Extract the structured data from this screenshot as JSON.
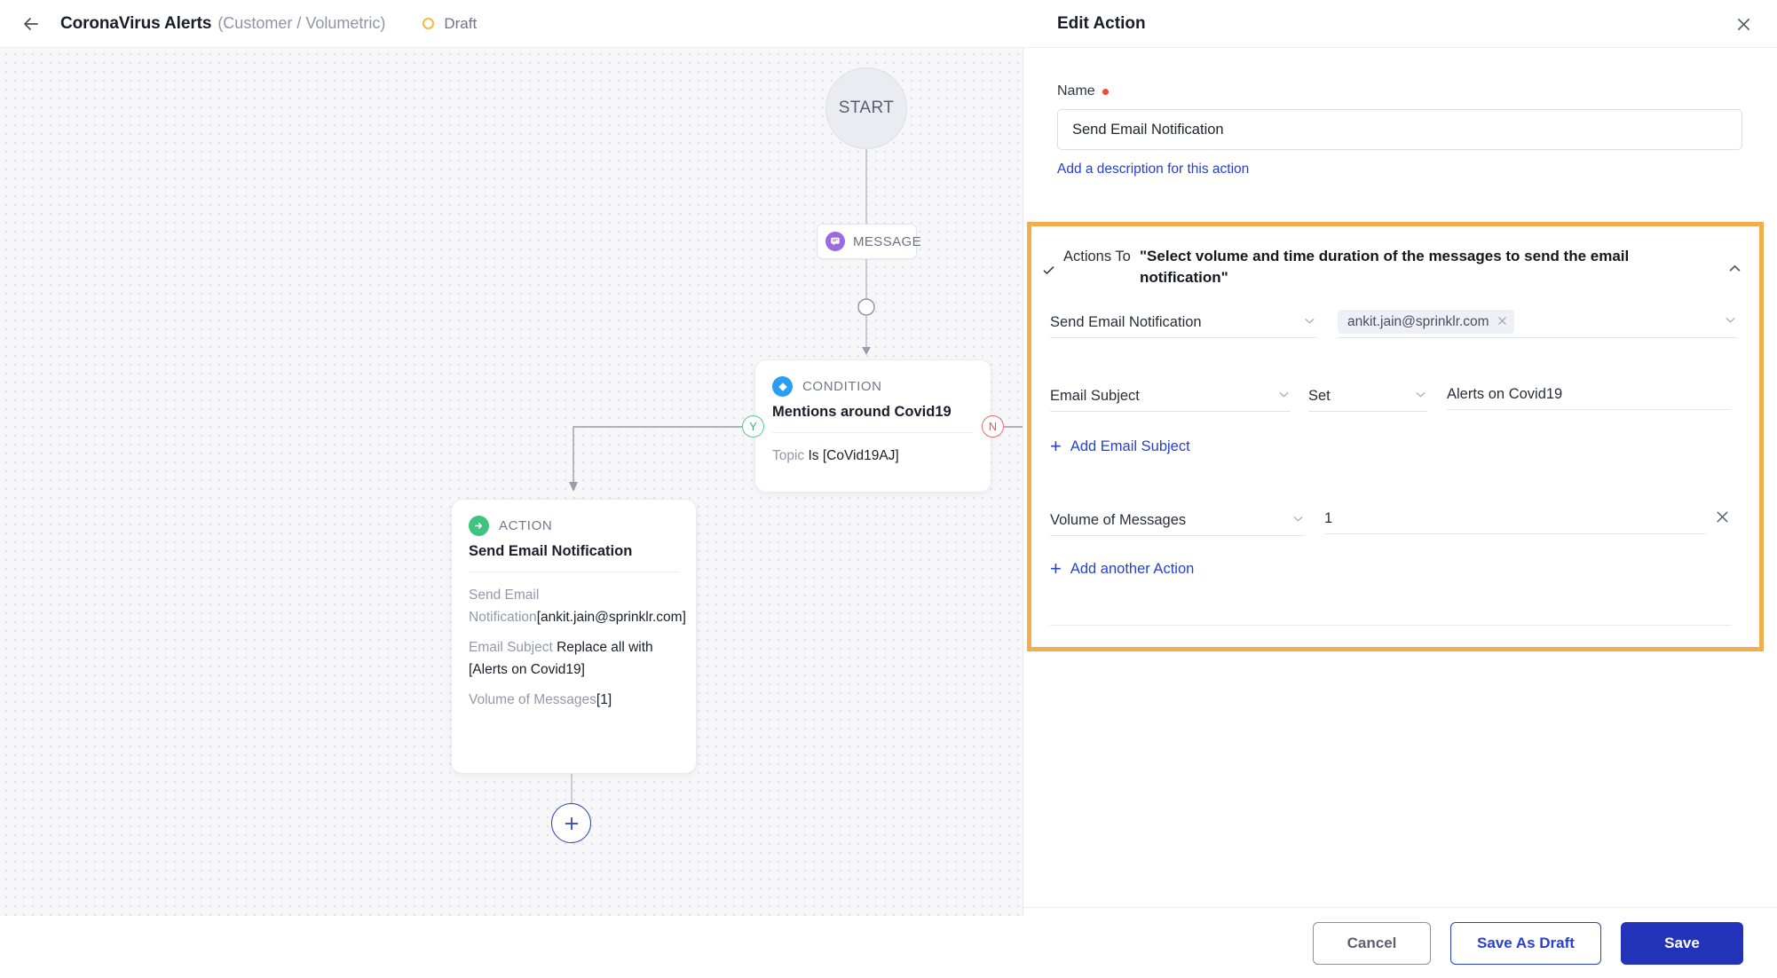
{
  "topbar": {
    "back_icon": "arrow-left-icon",
    "title": "CoronaVirus Alerts",
    "subtitle": "(Customer / Volumetric)",
    "status_label": "Draft",
    "status_color": "#f5b843"
  },
  "canvas": {
    "start_label": "START",
    "message_node": {
      "label": "MESSAGE",
      "icon": "chat-bubble-icon",
      "icon_color": "#9b6ae0"
    },
    "condition_node": {
      "kind": "CONDITION",
      "icon": "diamond-icon",
      "icon_color": "#2a9df4",
      "title": "Mentions around Covid19",
      "body_muted": "Topic",
      "body_value": "Is [CoVid19AJ]",
      "yes_label": "Y",
      "no_label": "N",
      "yes_color": "#5cc88c",
      "no_color": "#ef6b6b"
    },
    "action_node": {
      "kind": "ACTION",
      "icon": "arrow-right-circle-icon",
      "icon_color": "#3fc47f",
      "title": "Send Email Notification",
      "lines": [
        {
          "muted": "Send Email Notification",
          "value": "[ankit.jain@sprinklr.com]"
        },
        {
          "muted": "Email Subject ",
          "value": "Replace all with [Alerts on Covid19]"
        },
        {
          "muted": "Volume of Messages",
          "value": "[1]"
        }
      ]
    },
    "add_node_icon": "plus-icon"
  },
  "panel": {
    "title": "Edit Action",
    "close_icon": "close-icon",
    "name_label": "Name",
    "name_required": true,
    "name_value": "Send Email Notification",
    "name_placeholder": "Name",
    "add_description_link": "Add a description for this action"
  },
  "actions_to": {
    "highlight_color": "#f2ad4d",
    "check_icon": "check-icon",
    "label": "Actions To",
    "description": "\"Select volume and time duration of the messages to send the email notification\"",
    "collapse_icon": "chevron-up-icon",
    "rows": [
      {
        "type": "select-with-chips",
        "select_value": "Send Email Notification",
        "chips": [
          {
            "text": "ankit.jain@sprinklr.com",
            "remove_icon": "close-icon"
          }
        ],
        "chips_chevron": "chevron-down-icon"
      },
      {
        "type": "triple",
        "field": "Email Subject",
        "operator": "Set",
        "value": "Alerts on Covid19"
      },
      {
        "type": "link",
        "icon": "plus-icon",
        "label": "Add Email Subject"
      },
      {
        "type": "pair",
        "field": "Volume of Messages",
        "value": "1",
        "remove_icon": "close-icon"
      },
      {
        "type": "link",
        "icon": "plus-icon",
        "label": "Add another Action"
      }
    ]
  },
  "footer": {
    "cancel_label": "Cancel",
    "save_draft_label": "Save As Draft",
    "save_label": "Save",
    "primary_color": "#2233ba"
  }
}
